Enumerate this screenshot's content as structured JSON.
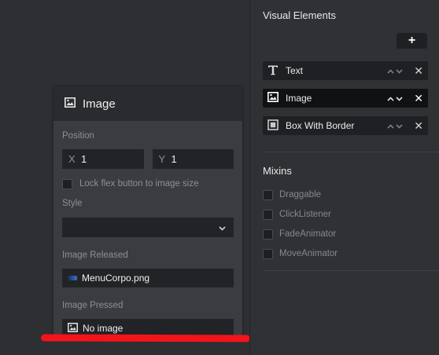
{
  "properties_panel": {
    "title": "Image",
    "title_icon": "image-icon",
    "position_label": "Position",
    "x_axis_label": "X",
    "x_value": "1",
    "y_axis_label": "Y",
    "y_value": "1",
    "lock_label": "Lock flex button to image size",
    "style_label": "Style",
    "style_value": "",
    "image_released_label": "Image Released",
    "image_released_value": "MenuCorpo.png",
    "image_pressed_label": "Image Pressed",
    "image_pressed_value": "No image"
  },
  "sidebar": {
    "visual_elements_title": "Visual Elements",
    "add_button_label": "+",
    "elements": [
      {
        "label": "Text",
        "icon": "text-icon",
        "selected": false
      },
      {
        "label": "Image",
        "icon": "image-icon",
        "selected": true
      },
      {
        "label": "Box With Border",
        "icon": "box-with-border-icon",
        "selected": false
      }
    ],
    "close_glyph": "✕",
    "mixins_title": "Mixins",
    "mixins": [
      "Draggable",
      "ClickListener",
      "FadeAnimator",
      "MoveAnimator"
    ]
  },
  "colors": {
    "annotation_underline": "#f3141a",
    "panel_background": "#3a3c40",
    "input_background": "#222326"
  }
}
